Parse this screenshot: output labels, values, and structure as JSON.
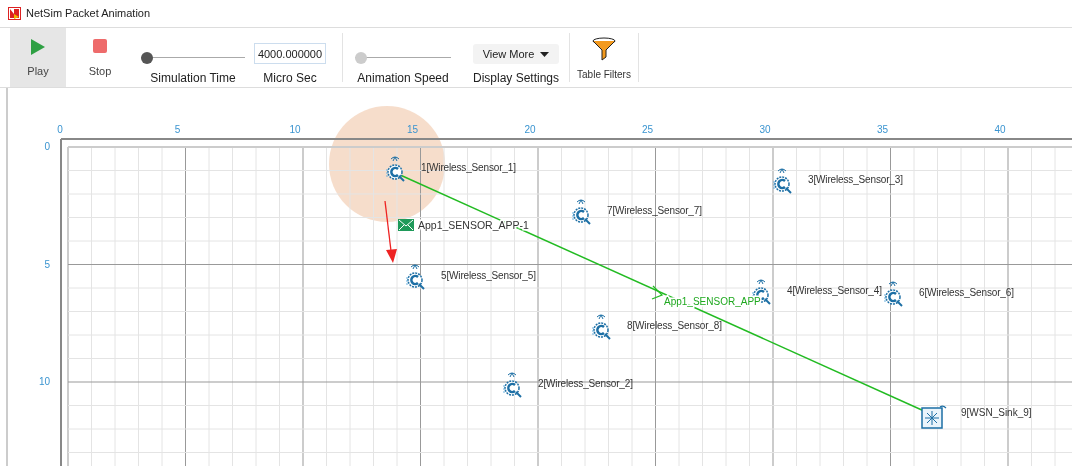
{
  "window": {
    "title": "NetSim Packet Animation"
  },
  "toolbar": {
    "play": {
      "label": "Play",
      "selected": true
    },
    "stop": {
      "label": "Stop"
    },
    "simulation_time": {
      "label": "Simulation Time",
      "level": 0
    },
    "time_field": {
      "value": "4000.000000",
      "label": "Micro Sec"
    },
    "animation_speed": {
      "label": "Animation Speed",
      "level": 0
    },
    "display_settings": {
      "button": "View More",
      "label": "Display Settings"
    },
    "table_filters": {
      "label": "Table Filters"
    }
  },
  "canvas": {
    "x_axis": {
      "ticks": [
        "0",
        "5",
        "10",
        "15",
        "20",
        "25",
        "30",
        "35",
        "40"
      ]
    },
    "y_axis": {
      "ticks": [
        "0",
        "5",
        "10"
      ]
    },
    "nodes": [
      {
        "label": "1[Wireless_Sensor_1]",
        "kind": "sensor"
      },
      {
        "label": "3[Wireless_Sensor_3]",
        "kind": "sensor"
      },
      {
        "label": "7[Wireless_Sensor_7]",
        "kind": "sensor"
      },
      {
        "label": "5[Wireless_Sensor_5]",
        "kind": "sensor"
      },
      {
        "label": "4[Wireless_Sensor_4]",
        "kind": "sensor"
      },
      {
        "label": "6[Wireless_Sensor_6]",
        "kind": "sensor"
      },
      {
        "label": "8[Wireless_Sensor_8]",
        "kind": "sensor"
      },
      {
        "label": "2[Wireless_Sensor_2]",
        "kind": "sensor"
      },
      {
        "label": "9[WSN_Sink_9]",
        "kind": "sink"
      }
    ],
    "packets": [
      {
        "label": "App1_SENSOR_APP-1",
        "kind": "envelope"
      },
      {
        "label": "App1_SENSOR_APP",
        "kind": "link"
      }
    ]
  }
}
